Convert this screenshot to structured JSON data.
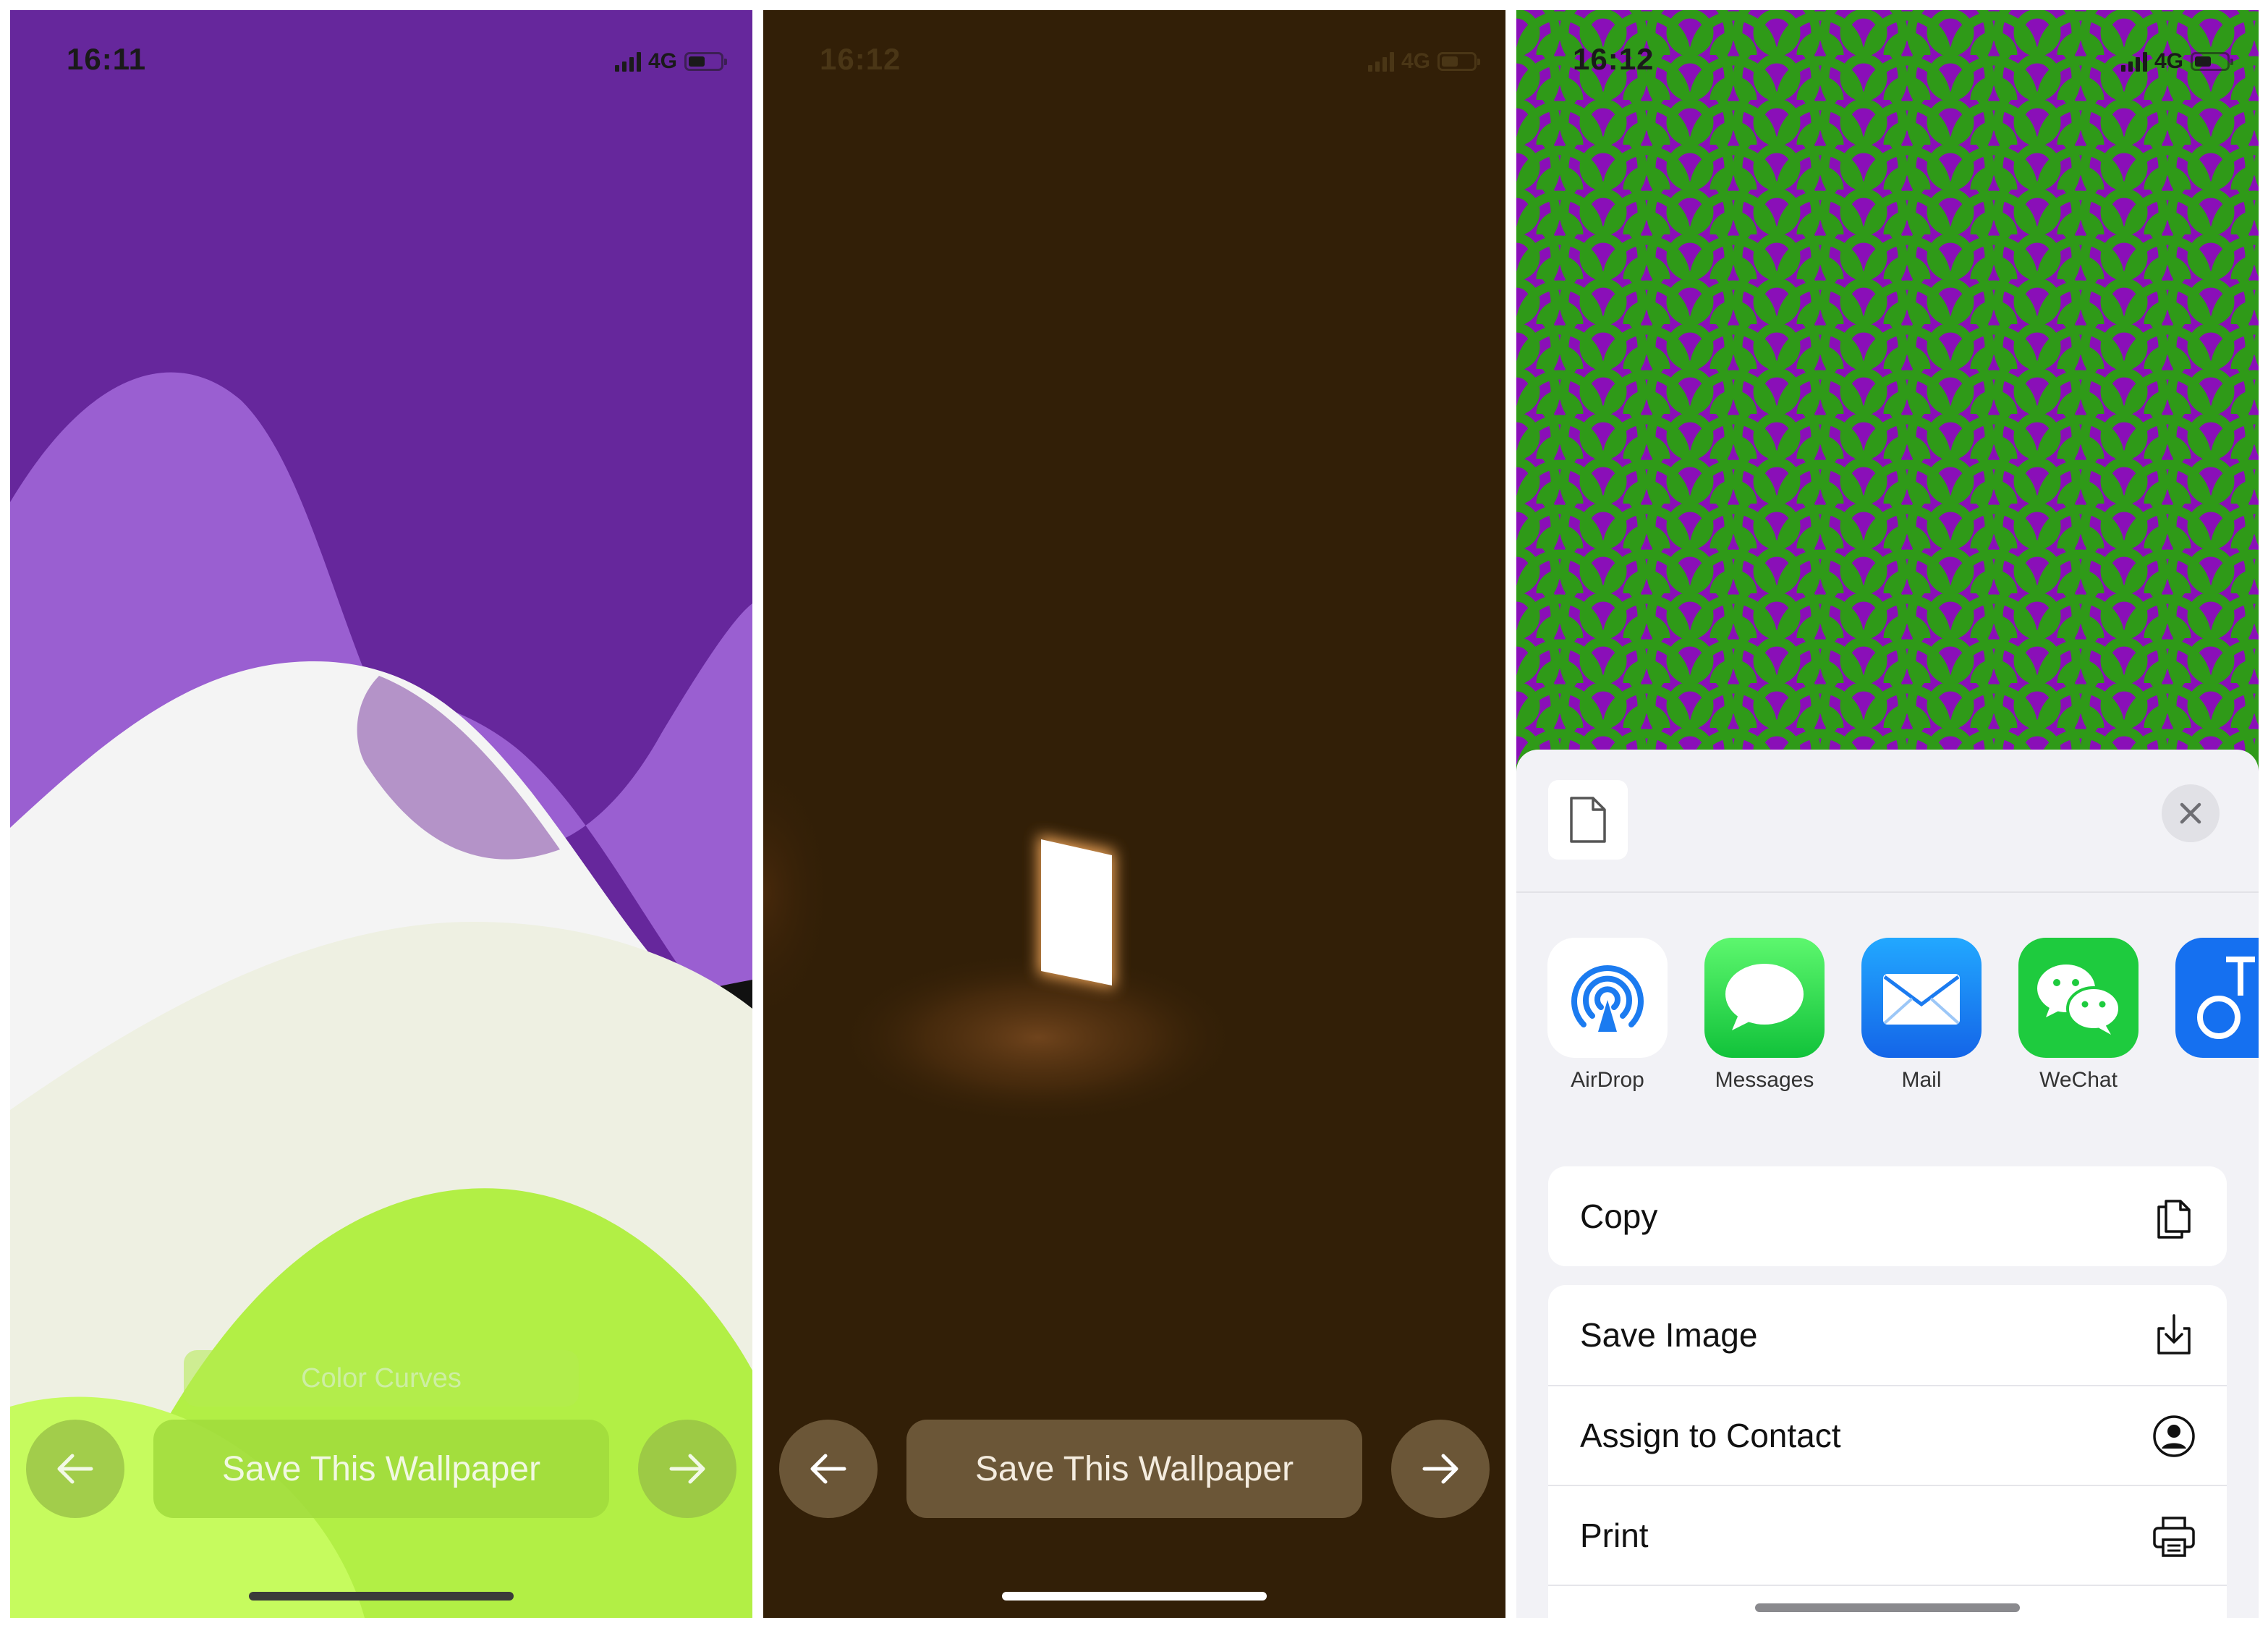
{
  "screens": [
    {
      "status": {
        "time": "16:11",
        "network": "4G"
      },
      "caption": "Color Curves",
      "save_label": "Save This Wallpaper",
      "prev_icon": "arrow-left-icon",
      "next_icon": "arrow-right-icon",
      "wallpaper_colors": [
        "#66279c",
        "#9a5fd1",
        "#f4f4f4",
        "#eef0e2",
        "#b2ef45",
        "#c6fb5e"
      ]
    },
    {
      "status": {
        "time": "16:12",
        "network": "4G"
      },
      "save_label": "Save This Wallpaper",
      "prev_icon": "arrow-left-icon",
      "next_icon": "arrow-right-icon",
      "wallpaper_colors": [
        "#321f07",
        "#ffffff",
        "#7a4a20"
      ]
    },
    {
      "status": {
        "time": "16:12",
        "network": "4G"
      },
      "wallpaper_colors": [
        "#8a0fb8",
        "#2f9a18"
      ],
      "share_sheet": {
        "close_icon": "close-icon",
        "document_icon": "document-icon",
        "apps": [
          {
            "label": "AirDrop",
            "icon": "airdrop-icon"
          },
          {
            "label": "Messages",
            "icon": "messages-icon"
          },
          {
            "label": "Mail",
            "icon": "mail-icon"
          },
          {
            "label": "WeChat",
            "icon": "wechat-icon"
          }
        ],
        "actions_primary": [
          {
            "label": "Copy",
            "icon": "copy-icon"
          }
        ],
        "actions_secondary": [
          {
            "label": "Save Image",
            "icon": "save-image-icon"
          },
          {
            "label": "Assign to Contact",
            "icon": "contact-icon"
          },
          {
            "label": "Print",
            "icon": "print-icon"
          }
        ]
      }
    }
  ]
}
